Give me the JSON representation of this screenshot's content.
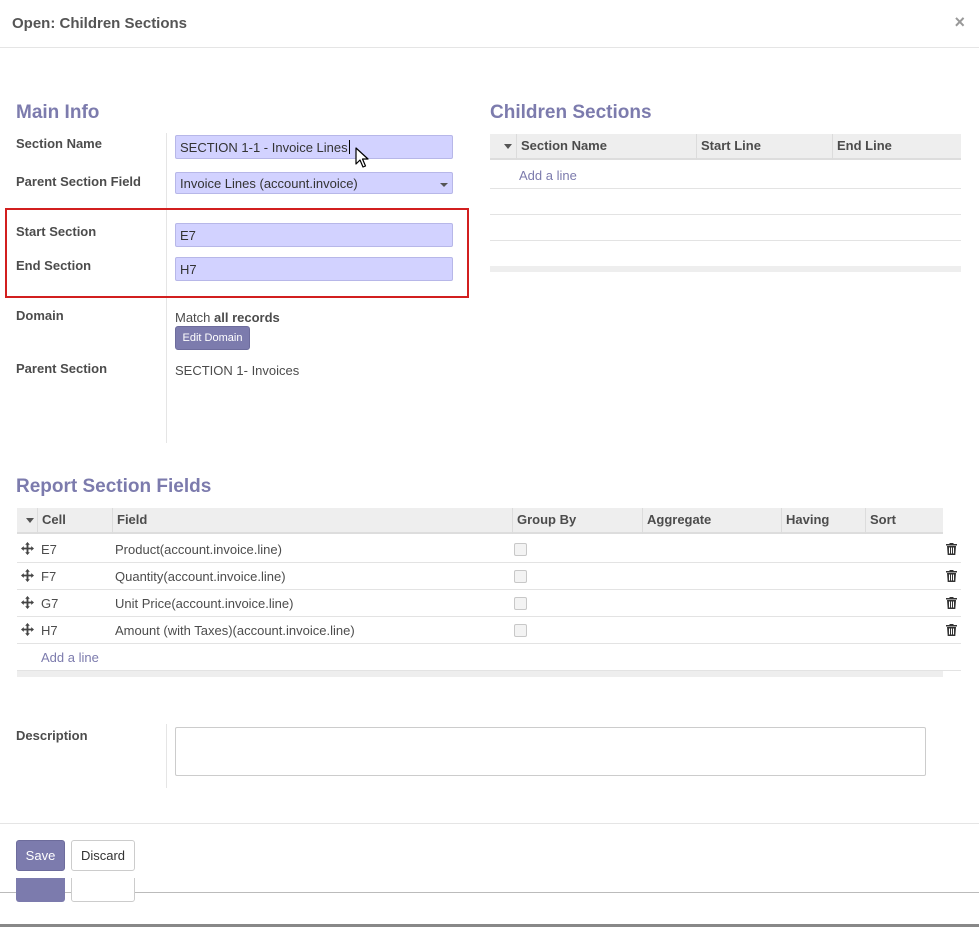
{
  "modal": {
    "title": "Open: Children Sections",
    "close_label": "×"
  },
  "main_info": {
    "heading": "Main Info",
    "section_name_label": "Section Name",
    "section_name_value": "SECTION 1-1 - Invoice Lines",
    "parent_section_field_label": "Parent Section Field",
    "parent_section_field_value": "Invoice Lines (account.invoice)",
    "start_section_label": "Start Section",
    "start_section_value": "E7",
    "end_section_label": "End Section",
    "end_section_value": "H7",
    "domain_label": "Domain",
    "domain_prefix": "Match",
    "domain_bold": "all records",
    "edit_domain_label": "Edit Domain",
    "parent_section_label": "Parent Section",
    "parent_section_value": "SECTION 1- Invoices"
  },
  "children_sections": {
    "heading": "Children Sections",
    "columns": [
      "Section Name",
      "Start Line",
      "End Line"
    ],
    "add_line": "Add a line"
  },
  "report_fields": {
    "heading": "Report Section Fields",
    "columns": [
      "Cell",
      "Field",
      "Group By",
      "Aggregate",
      "Having",
      "Sort"
    ],
    "rows": [
      {
        "cell": "E7",
        "field": "Product(account.invoice.line)"
      },
      {
        "cell": "F7",
        "field": "Quantity(account.invoice.line)"
      },
      {
        "cell": "G7",
        "field": "Unit Price(account.invoice.line)"
      },
      {
        "cell": "H7",
        "field": "Amount (with Taxes)(account.invoice.line)"
      }
    ],
    "add_line": "Add a line"
  },
  "description": {
    "label": "Description",
    "value": ""
  },
  "footer": {
    "save_label": "Save",
    "discard_label": "Discard"
  },
  "colors": {
    "accent": "#7c7bad",
    "input_bg": "#d2d2ff",
    "highlight": "#d21f1f"
  }
}
